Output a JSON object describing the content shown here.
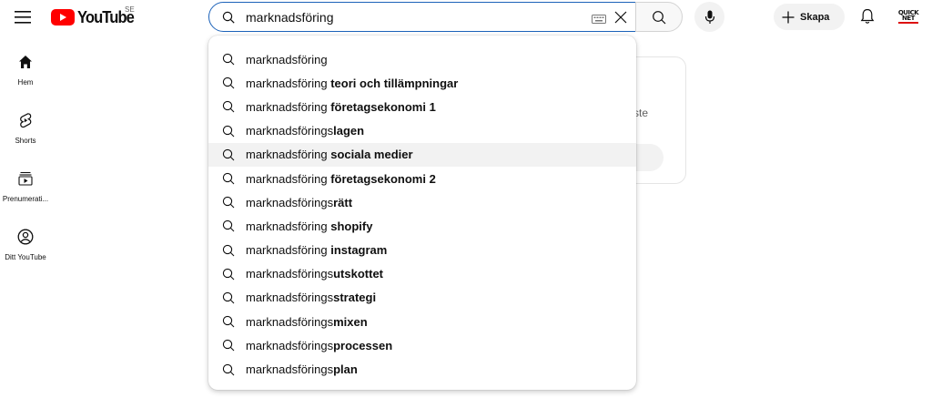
{
  "header": {
    "logo_text": "YouTube",
    "country_code": "SE",
    "search_value": "marknadsföring",
    "create_label": "Skapa",
    "avatar_text": "QUICK NET",
    "icons": {
      "menu": "hamburger-menu-icon",
      "search": "search-icon",
      "keyboard": "keyboard-icon",
      "clear": "close-icon",
      "mic": "microphone-icon",
      "create": "plus-icon",
      "notifications": "bell-icon"
    }
  },
  "sidebar": {
    "items": [
      {
        "label": "Hem",
        "icon": "home-icon"
      },
      {
        "label": "Shorts",
        "icon": "shorts-icon"
      },
      {
        "label": "Prenumerati...",
        "icon": "subscriptions-icon"
      },
      {
        "label": "Ditt YouTube",
        "icon": "account-icon"
      }
    ]
  },
  "background_card": {
    "partial_text": "ste"
  },
  "suggestions": [
    {
      "prefix": "marknadsföring",
      "bold": ""
    },
    {
      "prefix": "marknadsföring ",
      "bold": "teori och tillämpningar"
    },
    {
      "prefix": "marknadsföring ",
      "bold": "företagsekonomi 1"
    },
    {
      "prefix": "marknadsförings",
      "bold": "lagen"
    },
    {
      "prefix": "marknadsföring ",
      "bold": "sociala medier"
    },
    {
      "prefix": "marknadsföring ",
      "bold": "företagsekonomi 2"
    },
    {
      "prefix": "marknadsförings",
      "bold": "rätt"
    },
    {
      "prefix": "marknadsföring ",
      "bold": "shopify"
    },
    {
      "prefix": "marknadsföring ",
      "bold": "instagram"
    },
    {
      "prefix": "marknadsförings",
      "bold": "utskottet"
    },
    {
      "prefix": "marknadsförings",
      "bold": "strategi"
    },
    {
      "prefix": "marknadsförings",
      "bold": "mixen"
    },
    {
      "prefix": "marknadsförings",
      "bold": "processen"
    },
    {
      "prefix": "marknadsförings",
      "bold": "plan"
    }
  ],
  "highlighted_suggestion_index": 4,
  "colors": {
    "brand_red": "#ff0000",
    "search_border": "#1c62b9",
    "hover_gray": "#f2f2f2"
  }
}
